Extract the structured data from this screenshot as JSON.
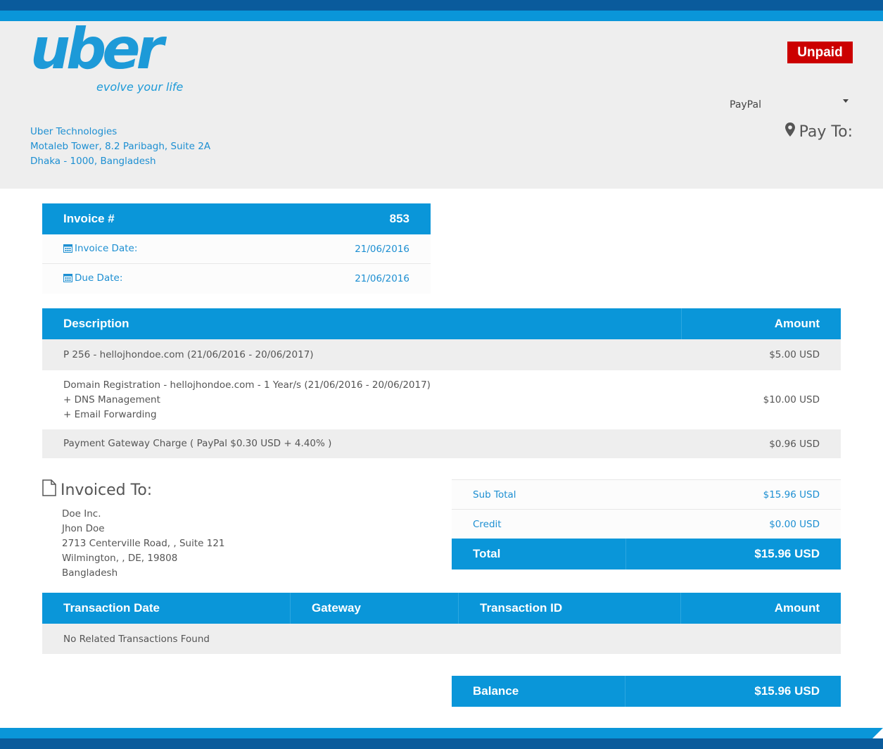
{
  "colors": {
    "primary": "#0a96d9",
    "primary_dark": "#0a5b9c",
    "link": "#1d8fd2",
    "unpaid": "#cc0000",
    "header_bg": "#eeeeee"
  },
  "logo": {
    "word": "uber",
    "tagline": "evolve your life"
  },
  "company": {
    "name": "Uber Technologies",
    "address_line1": "Motaleb Tower, 8.2 Paribagh, Suite 2A",
    "address_line2": "Dhaka - 1000, Bangladesh"
  },
  "status": "Unpaid",
  "gateway": {
    "selected": "PayPal"
  },
  "pay_to": {
    "icon": "map-marker-icon",
    "label": "Pay To:"
  },
  "invoice": {
    "number_label": "Invoice #",
    "number": "853",
    "date_label": "Invoice Date:",
    "date": "21/06/2016",
    "due_label": "Due Date:",
    "due": "21/06/2016"
  },
  "items": {
    "headers": {
      "description": "Description",
      "amount": "Amount"
    },
    "rows": [
      {
        "lines": [
          "P 256 - hellojhondoe.com (21/06/2016 - 20/06/2017)"
        ],
        "amount": "$5.00 USD"
      },
      {
        "lines": [
          "Domain Registration - hellojhondoe.com - 1 Year/s (21/06/2016 - 20/06/2017)",
          "+ DNS Management",
          "+ Email Forwarding"
        ],
        "amount": "$10.00 USD"
      },
      {
        "lines": [
          "Payment Gateway Charge ( PayPal $0.30 USD + 4.40% )"
        ],
        "amount": "$0.96 USD"
      }
    ]
  },
  "invoiced_to": {
    "title": "Invoiced To:",
    "lines": [
      "Doe Inc.",
      "Jhon Doe",
      "2713 Centerville Road, , Suite 121",
      "Wilmington, , DE, 19808",
      "Bangladesh"
    ]
  },
  "totals": {
    "subtotal_label": "Sub Total",
    "subtotal": "$15.96 USD",
    "credit_label": "Credit",
    "credit": "$0.00 USD",
    "total_label": "Total",
    "total": "$15.96 USD"
  },
  "transactions": {
    "headers": {
      "date": "Transaction Date",
      "gateway": "Gateway",
      "id": "Transaction ID",
      "amount": "Amount"
    },
    "empty": "No Related Transactions Found"
  },
  "balance": {
    "label": "Balance",
    "value": "$15.96 USD"
  }
}
